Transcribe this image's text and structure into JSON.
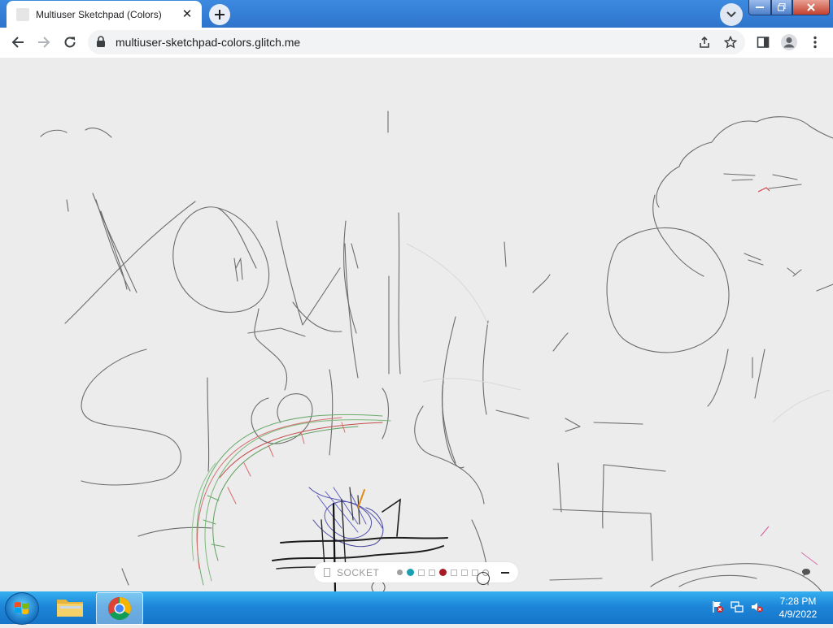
{
  "browser": {
    "tab": {
      "title": "Multiuser Sketchpad (Colors)"
    },
    "omnibox": {
      "url": "multiuser-sketchpad-colors.glitch.me"
    }
  },
  "app": {
    "socket_label": "SOCKET",
    "palette": [
      {
        "kind": "dot",
        "color": "#9e9e9e"
      },
      {
        "kind": "dot",
        "color": "#1a9fb0"
      },
      {
        "kind": "square",
        "color": "#ffffff"
      },
      {
        "kind": "square",
        "color": "#ffffff"
      },
      {
        "kind": "dot",
        "color": "#a81b22"
      },
      {
        "kind": "square",
        "color": "#ffffff"
      },
      {
        "kind": "square",
        "color": "#ffffff"
      },
      {
        "kind": "square",
        "color": "#ffffff"
      },
      {
        "kind": "ring",
        "color": "#ffffff"
      }
    ]
  },
  "taskbar": {
    "clock": {
      "time": "7:28 PM",
      "date": "4/9/2022"
    }
  },
  "colors": {
    "taskbar": "#1d86d8",
    "tabstrip": "#3079d4",
    "canvas": "#ececec"
  }
}
